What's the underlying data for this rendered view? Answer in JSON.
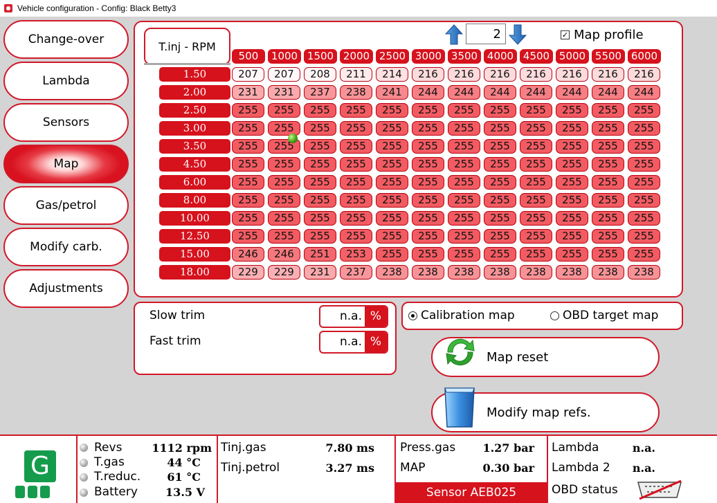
{
  "window": {
    "title": "Vehicle configuration - Config: Black Betty3"
  },
  "nav": [
    {
      "label": "Change-over",
      "active": false
    },
    {
      "label": "Lambda",
      "active": false
    },
    {
      "label": "Sensors",
      "active": false
    },
    {
      "label": "Map",
      "active": true
    },
    {
      "label": "Gas/petrol",
      "active": false
    },
    {
      "label": "Modify carb.",
      "active": false
    },
    {
      "label": "Adjustments",
      "active": false
    }
  ],
  "map": {
    "title": "T.inj - RPM",
    "profile_value": "2",
    "map_profile_label": "Map profile",
    "map_profile_checked": true,
    "rpm": [
      "500",
      "1000",
      "1500",
      "2000",
      "2500",
      "3000",
      "3500",
      "4000",
      "4500",
      "5000",
      "5500",
      "6000"
    ],
    "tinj": [
      "1.50",
      "2.00",
      "2.50",
      "3.00",
      "3.50",
      "4.50",
      "6.00",
      "8.00",
      "10.00",
      "12.50",
      "15.00",
      "18.00"
    ],
    "values": [
      [
        207,
        207,
        208,
        211,
        214,
        216,
        216,
        216,
        216,
        216,
        216,
        216
      ],
      [
        231,
        231,
        237,
        238,
        241,
        244,
        244,
        244,
        244,
        244,
        244,
        244
      ],
      [
        255,
        255,
        255,
        255,
        255,
        255,
        255,
        255,
        255,
        255,
        255,
        255
      ],
      [
        255,
        255,
        255,
        255,
        255,
        255,
        255,
        255,
        255,
        255,
        255,
        255
      ],
      [
        255,
        255,
        255,
        255,
        255,
        255,
        255,
        255,
        255,
        255,
        255,
        255
      ],
      [
        255,
        255,
        255,
        255,
        255,
        255,
        255,
        255,
        255,
        255,
        255,
        255
      ],
      [
        255,
        255,
        255,
        255,
        255,
        255,
        255,
        255,
        255,
        255,
        255,
        255
      ],
      [
        255,
        255,
        255,
        255,
        255,
        255,
        255,
        255,
        255,
        255,
        255,
        255
      ],
      [
        255,
        255,
        255,
        255,
        255,
        255,
        255,
        255,
        255,
        255,
        255,
        255
      ],
      [
        255,
        255,
        255,
        255,
        255,
        255,
        255,
        255,
        255,
        255,
        255,
        255
      ],
      [
        246,
        246,
        251,
        253,
        255,
        255,
        255,
        255,
        255,
        255,
        255,
        255
      ],
      [
        229,
        229,
        231,
        237,
        238,
        238,
        238,
        238,
        238,
        238,
        238,
        238
      ]
    ],
    "cursor": {
      "row": 4,
      "col": 1
    }
  },
  "trim": {
    "slow_label": "Slow trim",
    "slow_value": "n.a.",
    "fast_label": "Fast trim",
    "fast_value": "n.a.",
    "unit": "%"
  },
  "map_select": {
    "calibration_label": "Calibration map",
    "obd_label": "OBD target map",
    "selected": "calibration"
  },
  "actions": {
    "reset_label": "Map reset",
    "modify_label": "Modify map refs."
  },
  "status": {
    "logo": "G",
    "revs_label": "Revs",
    "revs_value": "1112 rpm",
    "tgas_label": "T.gas",
    "tgas_value": "44 °C",
    "treduc_label": "T.reduc.",
    "treduc_value": "61 °C",
    "battery_label": "Battery",
    "battery_value": "13.5 V",
    "tinj_gas_label": "Tinj.gas",
    "tinj_gas_value": "7.80 ms",
    "tinj_petrol_label": "Tinj.petrol",
    "tinj_petrol_value": "3.27 ms",
    "press_gas_label": "Press.gas",
    "press_gas_value": "1.27 bar",
    "map_label": "MAP",
    "map_value": "0.30 bar",
    "sensor": "Sensor AEB025",
    "lambda_label": "Lambda",
    "lambda_value": "n.a.",
    "lambda2_label": "Lambda 2",
    "lambda2_value": "n.a.",
    "obd_label": "OBD status"
  },
  "colors": {
    "accent": "#d6121d",
    "logo_green": "#149c4c",
    "cell_low": "#ffffff",
    "cell_high": "#f25b62"
  },
  "icons": [
    "arrow-up-icon",
    "arrow-down-icon",
    "recycle-icon",
    "bin-icon",
    "obd-disconnected-icon",
    "led-icon"
  ]
}
